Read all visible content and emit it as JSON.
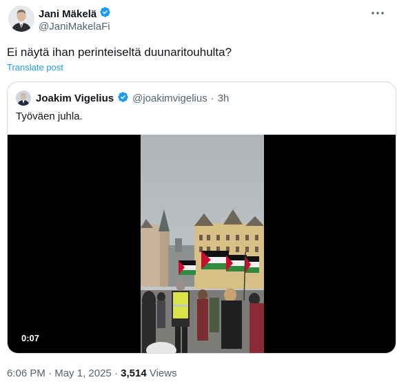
{
  "post": {
    "author_name": "Jani Mäkelä",
    "author_handle": "@JaniMakelaFi",
    "text": "Ei näytä ihan perinteiseltä duunaritouhulta?",
    "translate_label": "Translate post",
    "more_icon": "more-horizontal-icon"
  },
  "quote": {
    "author_name": "Joakim Vigelius",
    "author_handle": "@joakimvigelius",
    "separator": "·",
    "time_ago": "3h",
    "text": "Työväen juhla.",
    "video": {
      "duration": "0:07"
    }
  },
  "footer": {
    "time": "6:06 PM",
    "sep1": "·",
    "date": "May 1, 2025",
    "sep2": "·",
    "views_count": "3,514",
    "views_label": "Views"
  },
  "colors": {
    "verified": "#1d9bf0",
    "link": "#1d9bf0",
    "secondary_text": "#536471",
    "border": "#cfd9de"
  }
}
